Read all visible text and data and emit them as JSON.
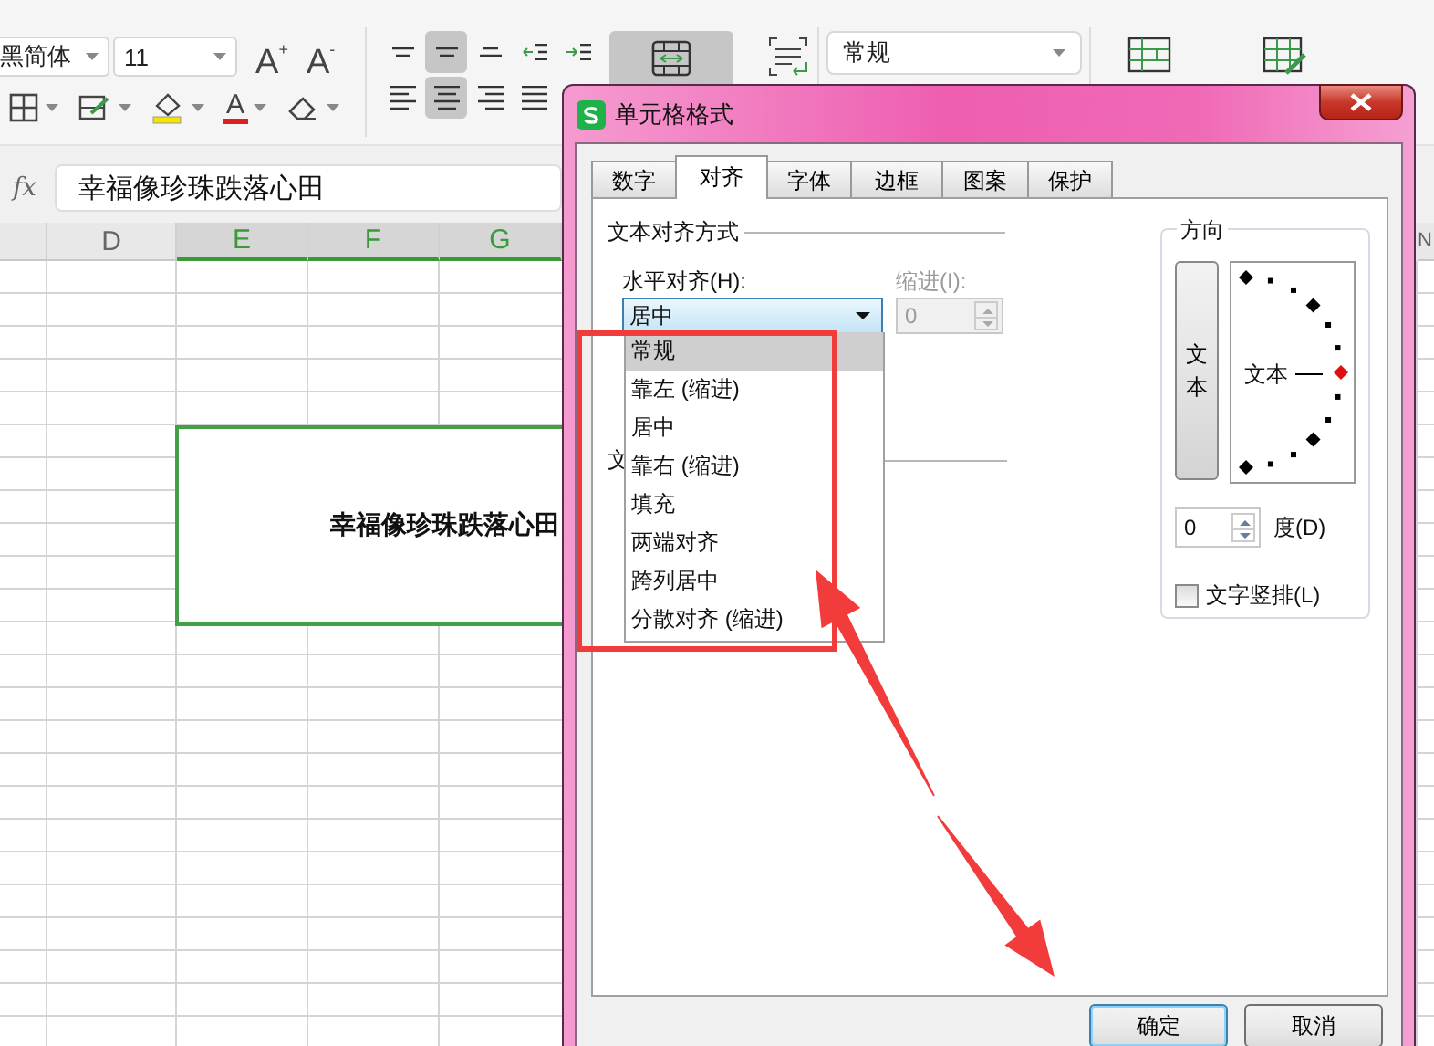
{
  "ribbon": {
    "font_name": "黑简体",
    "font_size": "11",
    "font_grow": "A$^{+}$",
    "font_shrink": "A$^{-}$",
    "font_color_letter": "A",
    "align_buttons": [
      {
        "kind": "top",
        "selected": false
      },
      {
        "kind": "middle",
        "selected": true
      },
      {
        "kind": "bottom",
        "selected": false
      },
      {
        "kind": "outdent",
        "selected": false
      },
      {
        "kind": "indent",
        "selected": false
      },
      {
        "kind": "left",
        "selected": false
      },
      {
        "kind": "center",
        "selected": true
      },
      {
        "kind": "right",
        "selected": false
      },
      {
        "kind": "justify",
        "selected": false
      }
    ],
    "merge_selected": true,
    "number_format": "常规"
  },
  "formula_bar": {
    "label": "fx",
    "value": "幸福像珍珠跌落心田"
  },
  "grid": {
    "columns": [
      {
        "label": "D",
        "selected": false
      },
      {
        "label": "E",
        "selected": true
      },
      {
        "label": "F",
        "selected": true
      },
      {
        "label": "G",
        "selected": true
      }
    ],
    "right_edge_column": "N",
    "merged_cell": "幸福像珍珠跌落心田"
  },
  "dialog": {
    "title": "单元格格式",
    "tabs": [
      {
        "label": "数字",
        "selected": false
      },
      {
        "label": "对齐",
        "selected": true
      },
      {
        "label": "字体",
        "selected": false
      },
      {
        "label": "边框",
        "selected": false
      },
      {
        "label": "图案",
        "selected": false
      },
      {
        "label": "保护",
        "selected": false
      }
    ],
    "alignment_group": {
      "legend": "文本对齐方式",
      "horizontal_label": "水平对齐(H):",
      "horizontal_value": "居中",
      "indent_label": "缩进(I):",
      "indent_value": "0",
      "indent_disabled": true,
      "options": [
        {
          "label": "常规",
          "selected": true
        },
        {
          "label": "靠左 (缩进)",
          "selected": false
        },
        {
          "label": "居中",
          "selected": false
        },
        {
          "label": "靠右 (缩进)",
          "selected": false
        },
        {
          "label": "填充",
          "selected": false
        },
        {
          "label": "两端对齐",
          "selected": false
        },
        {
          "label": "跨列居中",
          "selected": false
        },
        {
          "label": "分散对齐 (缩进)",
          "selected": false
        }
      ],
      "next_group_legend": "文"
    },
    "orientation": {
      "legend": "方向",
      "vertical_text": "文本",
      "dial_text": "文本",
      "degrees": "0",
      "degrees_label": "度(D)",
      "vertical_checkbox": {
        "label": "文字竖排(L)",
        "checked": false
      }
    },
    "buttons": [
      {
        "label": "确定",
        "default": true
      },
      {
        "label": "取消",
        "default": false
      }
    ]
  }
}
